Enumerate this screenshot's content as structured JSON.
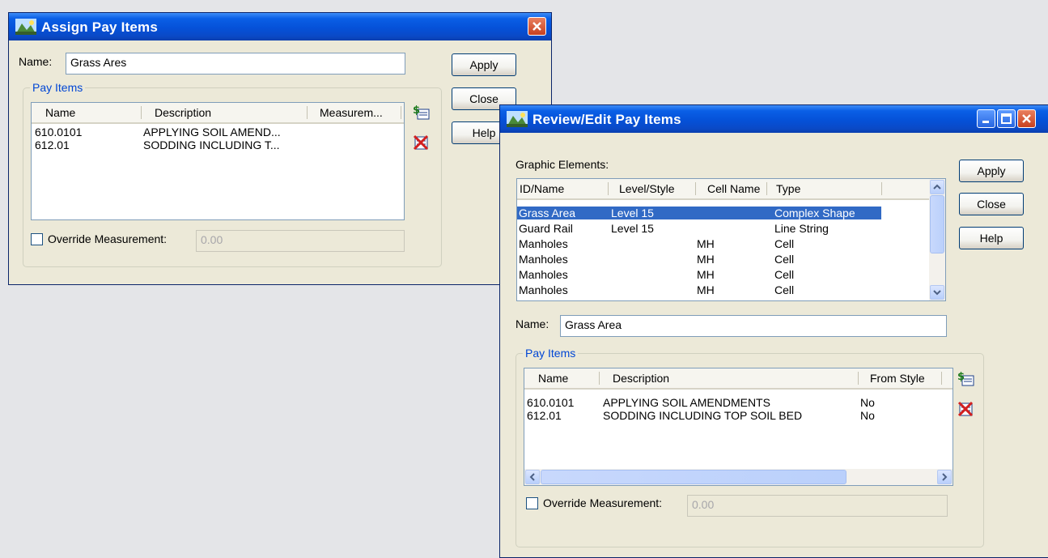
{
  "assign_dialog": {
    "title": "Assign Pay Items",
    "name_label": "Name:",
    "name_value": "Grass Ares",
    "apply_label": "Apply",
    "close_label": "Close",
    "help_label": "Help",
    "pay_items_group": "Pay Items",
    "columns": [
      "Name",
      "Description",
      "Measurem..."
    ],
    "rows": [
      {
        "name": "610.0101",
        "description": "APPLYING SOIL AMEND...",
        "measurement": ""
      },
      {
        "name": "612.01",
        "description": "SODDING INCLUDING T...",
        "measurement": ""
      }
    ],
    "override_label": "Override Measurement:",
    "override_value": "0.00"
  },
  "review_dialog": {
    "title": "Review/Edit Pay Items",
    "graphic_elements_label": "Graphic Elements:",
    "ge_columns": [
      "ID/Name",
      "Level/Style",
      "Cell Name",
      "Type"
    ],
    "ge_rows": [
      {
        "id": "Grass Area",
        "level": "Level 15",
        "cell": "",
        "type": "Complex Shape",
        "selected": true
      },
      {
        "id": "Guard Rail",
        "level": "Level 15",
        "cell": "",
        "type": "Line String",
        "selected": false
      },
      {
        "id": "Manholes",
        "level": "",
        "cell": "MH",
        "type": "Cell",
        "selected": false
      },
      {
        "id": "Manholes",
        "level": "",
        "cell": "MH",
        "type": "Cell",
        "selected": false
      },
      {
        "id": "Manholes",
        "level": "",
        "cell": "MH",
        "type": "Cell",
        "selected": false
      },
      {
        "id": "Manholes",
        "level": "",
        "cell": "MH",
        "type": "Cell",
        "selected": false
      }
    ],
    "apply_label": "Apply",
    "close_label": "Close",
    "help_label": "Help",
    "name_label": "Name:",
    "name_value": "Grass Area",
    "pay_items_group": "Pay Items",
    "pi_columns": [
      "Name",
      "Description",
      "From Style"
    ],
    "pi_rows": [
      {
        "name": "610.0101",
        "description": "APPLYING SOIL AMENDMENTS",
        "from_style": "No"
      },
      {
        "name": "612.01",
        "description": "SODDING INCLUDING TOP SOIL BED",
        "from_style": "No"
      }
    ],
    "override_label": "Override Measurement:",
    "override_value": "0.00"
  },
  "icons": {
    "add": "add-pay-item-icon",
    "delete": "delete-pay-item-icon",
    "app": "app-icon"
  },
  "colors": {
    "titlebar": "#0a5fe6",
    "selection": "#316ac5",
    "dialog_bg": "#ece9d8",
    "desktop": "#e4e5e8"
  }
}
